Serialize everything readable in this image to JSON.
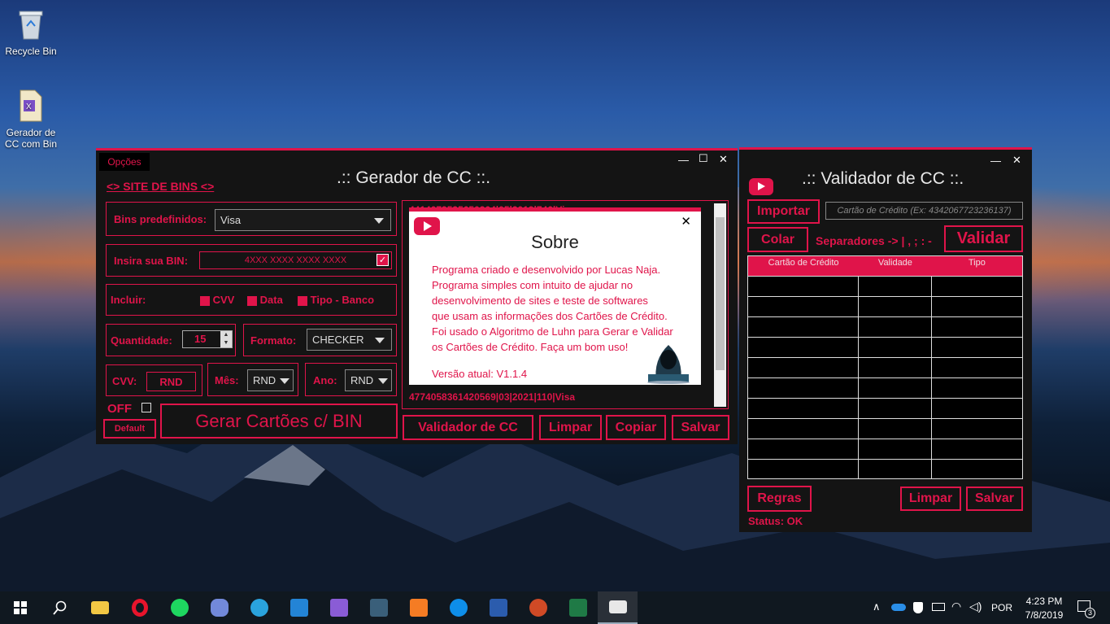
{
  "desktop": {
    "icons": [
      {
        "label": "Recycle Bin",
        "icon": "recycle-bin-icon"
      },
      {
        "label": "Gerador de CC com Bin",
        "icon": "vs-project-icon"
      }
    ]
  },
  "gerador": {
    "menu_label": "Opções",
    "title": ".:: Gerador de CC ::.",
    "site_link": "<> SITE DE BINS <>",
    "bins_label": "Bins predefinidos:",
    "bins_value": "Visa",
    "bin_label": "Insira sua BIN:",
    "bin_value": "4XXX XXXX XXXX XXXX",
    "incluir_label": "Incluir:",
    "incluir_options": [
      "CVV",
      "Data",
      "Tipo - Banco"
    ],
    "quantidade_label": "Quantidade:",
    "quantidade_value": "15",
    "formato_label": "Formato:",
    "formato_value": "CHECKER",
    "cvv_label": "CVV:",
    "cvv_value": "RND",
    "mes_label": "Mês:",
    "mes_value": "RND",
    "ano_label": "Ano:",
    "ano_value": "RND",
    "off_label": "OFF",
    "default_button": "Default",
    "generate_button": "Gerar Cartões c/ BIN",
    "output_first_line": "4414073535650364|05|2019|746|Visa",
    "output_last_line": "4774058361420569|03|2021|110|Visa",
    "validador_button": "Validador de CC",
    "limpar_button": "Limpar",
    "copiar_button": "Copiar",
    "salvar_button": "Salvar"
  },
  "sobre": {
    "title": "Sobre",
    "lines": [
      "Programa criado e desenvolvido por Lucas Naja.",
      "Programa simples com intuito de ajudar no",
      "desenvolvimento de sites e teste de softwares",
      "que usam as informações dos Cartões de Crédito.",
      "Foi usado o Algoritmo de Luhn para Gerar e Validar",
      "os Cartões de Crédito. Faça um bom uso!"
    ],
    "version": "Versão atual: V1.1.4"
  },
  "validador": {
    "title": ".:: Validador de CC ::.",
    "importar_button": "Importar",
    "input_placeholder": "Cartão de Crédito (Ex: 4342067723236137)",
    "colar_button": "Colar",
    "separadores_label": "Separadores -> | , ; : -",
    "validar_button": "Validar",
    "columns": [
      "Cartão de Crédito",
      "Validade",
      "Tipo"
    ],
    "regras_button": "Regras",
    "limpar_button": "Limpar",
    "salvar_button": "Salvar",
    "status": "Status: OK"
  },
  "taskbar": {
    "apps": [
      "windows-start-icon",
      "search-icon",
      "file-explorer-icon",
      "opera-icon",
      "spotify-icon",
      "discord-icon",
      "telegram-icon",
      "vscode-icon",
      "visual-studio-icon",
      "mysql-workbench-icon",
      "xampp-icon",
      "teamviewer-icon",
      "word-icon",
      "powerpoint-icon",
      "excel-icon",
      "card-app-icon"
    ],
    "language": "POR",
    "time": "4:23 PM",
    "date": "7/8/2019",
    "notification_count": "3"
  },
  "colors": {
    "accent": "#e0144a",
    "window_bg": "#141414"
  }
}
